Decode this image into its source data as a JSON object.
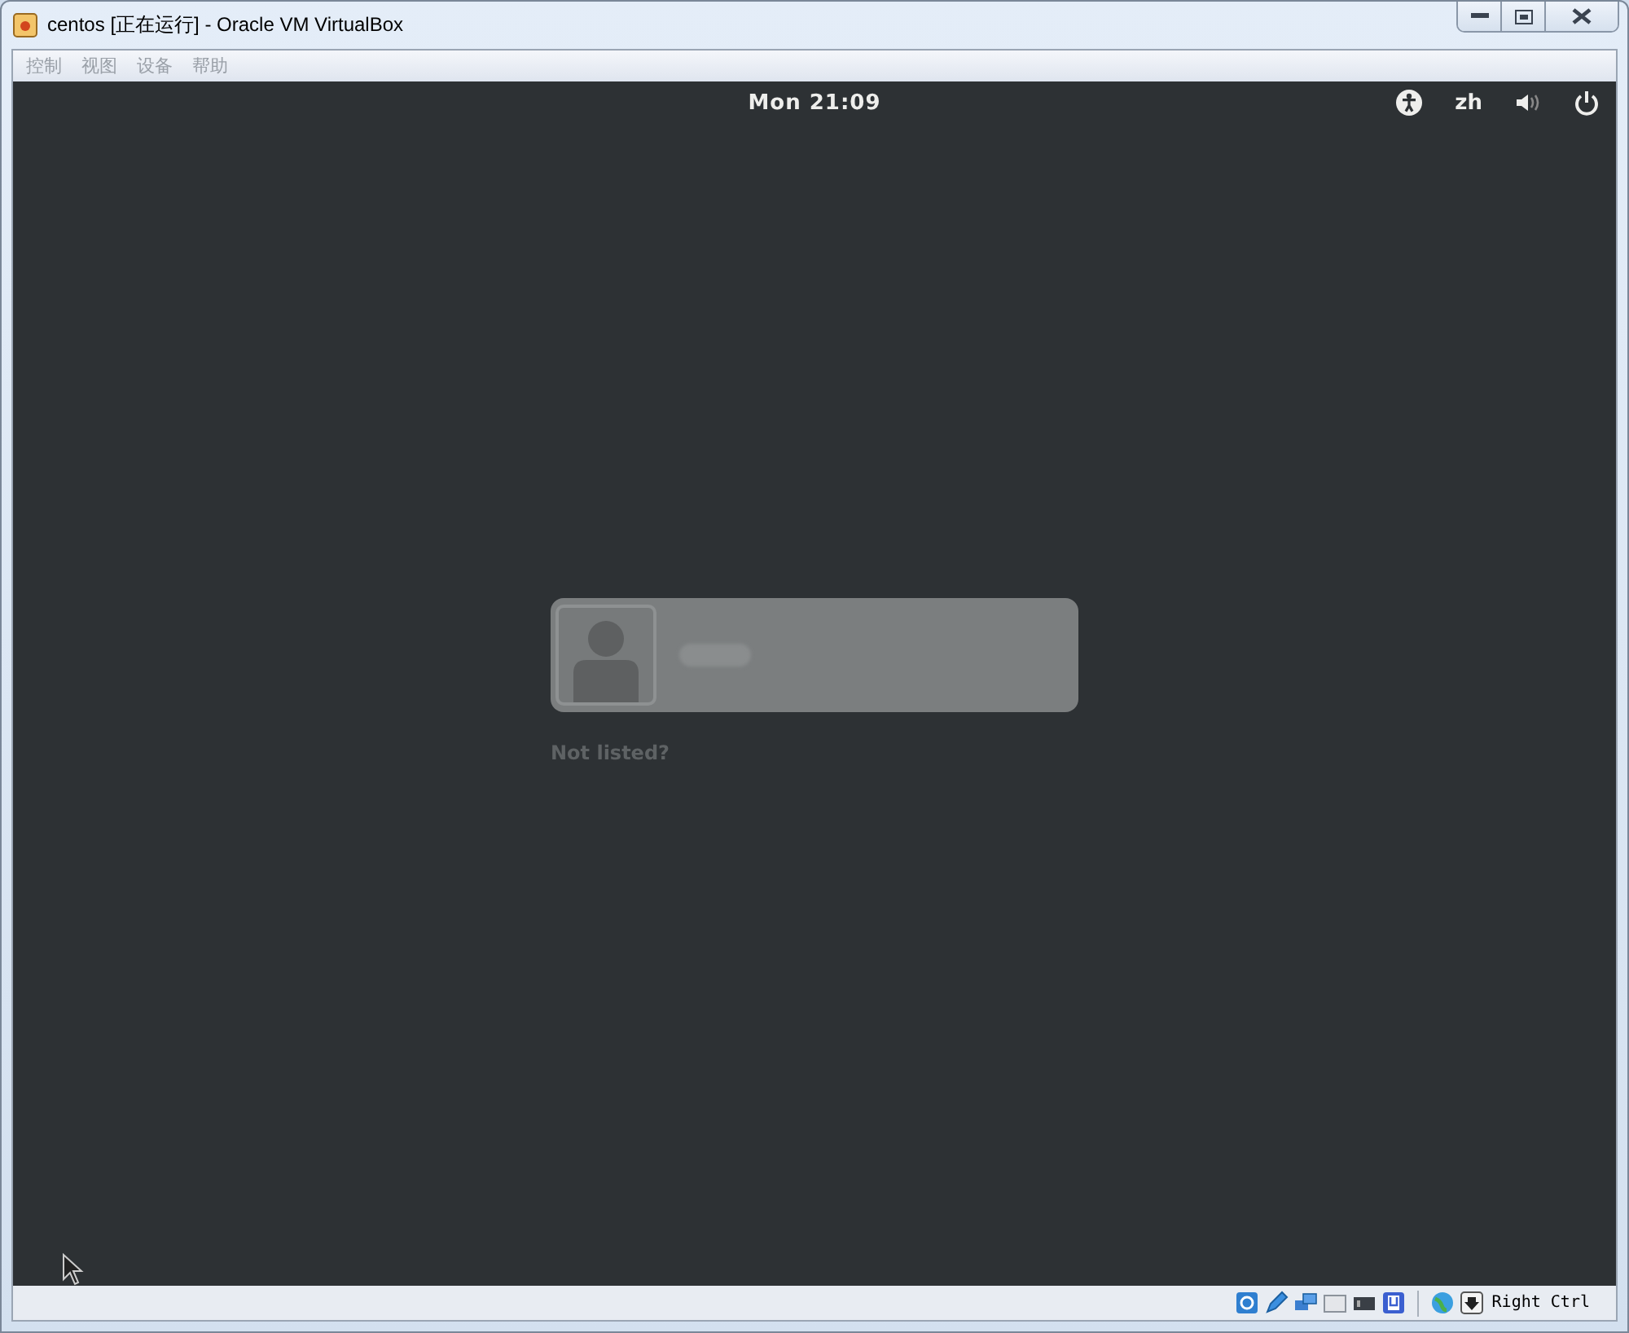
{
  "window": {
    "title": "centos [正在运行] - Oracle VM VirtualBox"
  },
  "menu": [
    {
      "label": "控制",
      "disabled": true
    },
    {
      "label": "视图",
      "disabled": true
    },
    {
      "label": "设备",
      "disabled": true
    },
    {
      "label": "帮助",
      "disabled": true
    }
  ],
  "top_bar": {
    "clock": "Mon 21:09",
    "language": "zh"
  },
  "login": {
    "users": [
      {
        "kind": "redacted"
      }
    ],
    "not_listed": "Not listed?"
  },
  "status_bar": {
    "host_key": "Right Ctrl"
  }
}
